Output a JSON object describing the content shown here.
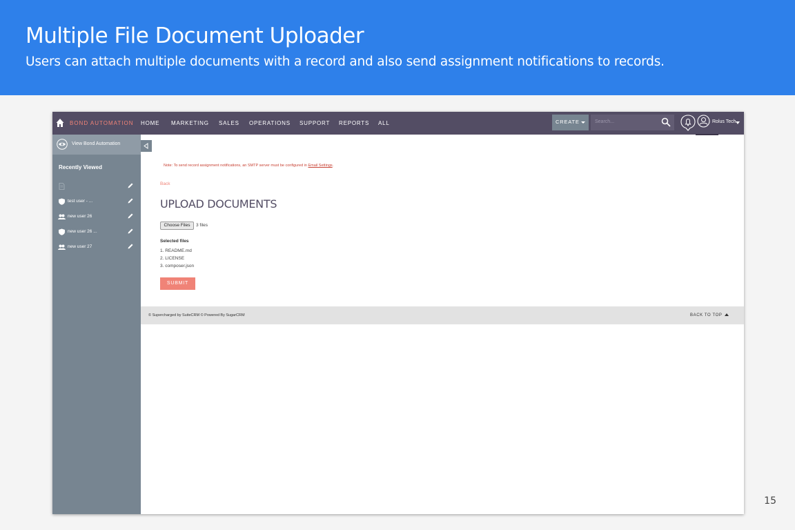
{
  "slide": {
    "title": "Multiple File Document Uploader",
    "subtitle": "Users can attach multiple documents with a record and also send assignment notifications to records.",
    "page_number": "15",
    "banner_color": "#2e80ea"
  },
  "nav": {
    "brand": "BOND AUTOMATION",
    "items": [
      "HOME",
      "MARKETING",
      "SALES",
      "OPERATIONS",
      "SUPPORT",
      "REPORTS",
      "ALL"
    ],
    "create_label": "CREATE",
    "search_placeholder": "Search...",
    "user_name": "Rolus Tech",
    "bar_color": "#534d64",
    "accent_color": "#f08377"
  },
  "sidebar": {
    "view_action": "View Bond Automation",
    "recent_title": "Recently Viewed",
    "recent_items": [
      {
        "label": "",
        "icon": "document-icon"
      },
      {
        "label": "test user - ...",
        "icon": "shield-icon"
      },
      {
        "label": "new user 26",
        "icon": "users-icon"
      },
      {
        "label": "new user 26 ...",
        "icon": "shield-icon"
      },
      {
        "label": "new user 27",
        "icon": "users-icon"
      }
    ]
  },
  "main": {
    "note_text": "Note: To send record assignment notifications, an SMTP server must be configured in ",
    "note_link": "Email Settings",
    "note_end": ".",
    "back_label": "Back",
    "title": "UPLOAD DOCUMENTS",
    "choose_files_label": "Choose Files",
    "file_count": "3 files",
    "selected_label": "Selected files",
    "files": [
      "1. README.md",
      "2. LICENSE",
      "3. composer.json"
    ],
    "submit_label": "SUBMIT"
  },
  "footer": {
    "left_text": "© Supercharged by SuiteCRM   © Powered By SugarCRM",
    "back_to_top": "BACK TO TOP"
  }
}
